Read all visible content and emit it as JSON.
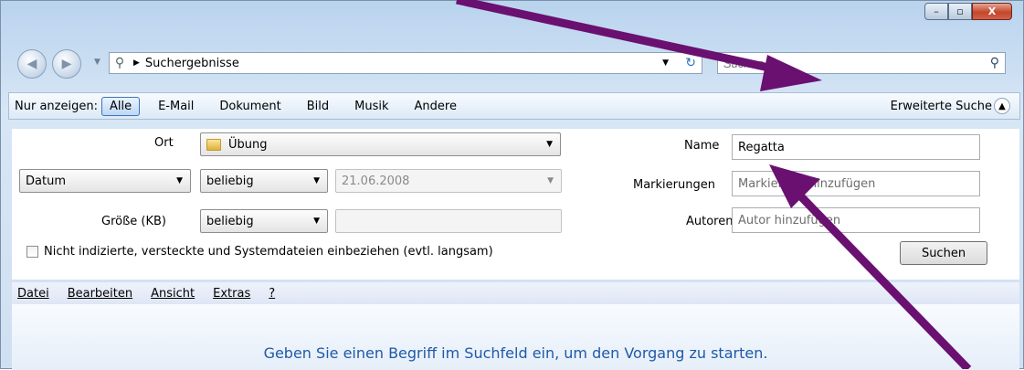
{
  "window": {
    "caption": {
      "minimize": "–",
      "maximize": "▫",
      "close": "X"
    }
  },
  "nav": {
    "path_label": "Suchergebnisse",
    "search_placeholder": "Suchen"
  },
  "filterbar": {
    "label": "Nur anzeigen:",
    "items": [
      "Alle",
      "E-Mail",
      "Dokument",
      "Bild",
      "Musik",
      "Andere"
    ],
    "active": "Alle",
    "advanced_label": "Erweiterte Suche"
  },
  "advanced": {
    "ort_label": "Ort",
    "ort_value": "Übung",
    "datum_field": "Datum",
    "datum_op": "beliebig",
    "datum_value": "21.06.2008",
    "groesse_label": "Größe (KB)",
    "groesse_op": "beliebig",
    "include_label": "Nicht indizierte, versteckte und Systemdateien einbeziehen (evtl. langsam)",
    "name_label": "Name",
    "name_value": "Regatta",
    "markierungen_label": "Markierungen",
    "markierungen_placeholder": "Markierung hinzufügen",
    "autoren_label": "Autoren",
    "autoren_placeholder": "Autor hinzufügen",
    "suchen_button": "Suchen"
  },
  "menu": {
    "items": [
      "Datei",
      "Bearbeiten",
      "Ansicht",
      "Extras",
      "?"
    ]
  },
  "content": {
    "hint": "Geben Sie einen Begriff im Suchfeld ein, um den Vorgang zu starten."
  },
  "colors": {
    "arrow": "#6a1070",
    "hint": "#1e5aa8"
  }
}
